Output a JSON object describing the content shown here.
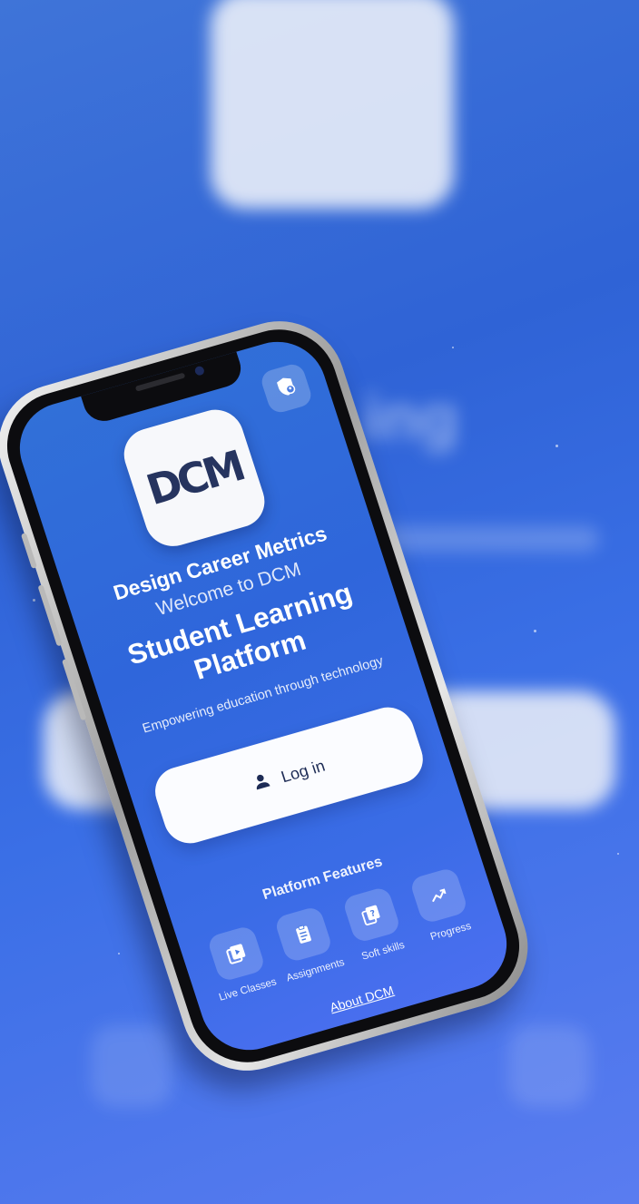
{
  "app": {
    "logo_text": "DCM",
    "brand_name": "Design Career Metrics",
    "welcome": "Welcome to DCM",
    "headline_line1": "Student Learning",
    "headline_line2": "Platform",
    "tagline": "Empowering education through technology"
  },
  "login": {
    "label": "Log in",
    "icon": "person-icon"
  },
  "features": {
    "title": "Platform Features",
    "items": [
      {
        "label": "Live Classes",
        "icon": "video-library-icon"
      },
      {
        "label": "Assignments",
        "icon": "clipboard-icon"
      },
      {
        "label": "Soft skills",
        "icon": "quiz-icon"
      },
      {
        "label": "Progress",
        "icon": "trending-up-icon"
      }
    ]
  },
  "footer": {
    "about_link": "About DCM"
  },
  "header": {
    "admin_icon": "shield-person-icon"
  },
  "colors": {
    "accent": "#2f66db",
    "brand_dark": "#26345f",
    "card": "#fbfcff"
  }
}
